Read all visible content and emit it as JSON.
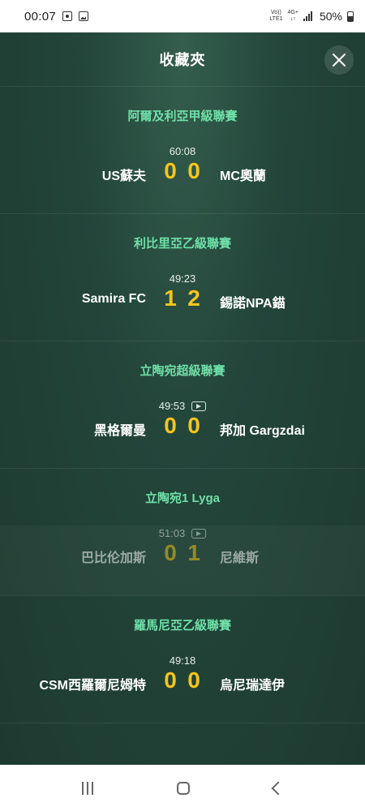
{
  "status": {
    "time": "00:07",
    "net_top": "Vo))",
    "net_bottom": "LTE1",
    "gen_top": "4G+",
    "gen_bottom": "↓↑",
    "battery": "50%"
  },
  "header": {
    "title": "收藏夾"
  },
  "sections": [
    {
      "league": "阿爾及利亞甲級聯賽",
      "time": "60:08",
      "video": false,
      "home": "US蘇夫",
      "home_score": "0",
      "away_score": "0",
      "away": "MC奧蘭",
      "dimmed": false
    },
    {
      "league": "利比里亞乙級聯賽",
      "time": "49:23",
      "video": false,
      "home": "Samira FC",
      "home_score": "1",
      "away_score": "2",
      "away": "錫諾NPA錨",
      "dimmed": false
    },
    {
      "league": "立陶宛超級聯賽",
      "time": "49:53",
      "video": true,
      "home": "黑格爾曼",
      "home_score": "0",
      "away_score": "0",
      "away": "邦加 Gargzdai",
      "dimmed": false
    },
    {
      "league": "立陶宛1 Lyga",
      "time": "51:03",
      "video": true,
      "home": "巴比伦加斯",
      "home_score": "0",
      "away_score": "1",
      "away": "尼維斯",
      "dimmed": true
    },
    {
      "league": "羅馬尼亞乙級聯賽",
      "time": "49:18",
      "video": false,
      "home": "CSM西羅爾尼姆特",
      "home_score": "0",
      "away_score": "0",
      "away": "烏尼瑞達伊",
      "dimmed": false
    }
  ],
  "colors": {
    "background": "#1f3a30",
    "league_text": "#6fe0a8",
    "score": "#f5c518"
  },
  "icons": [
    "close-icon",
    "play-video-icon",
    "recent-apps-icon",
    "home-icon",
    "back-icon"
  ]
}
